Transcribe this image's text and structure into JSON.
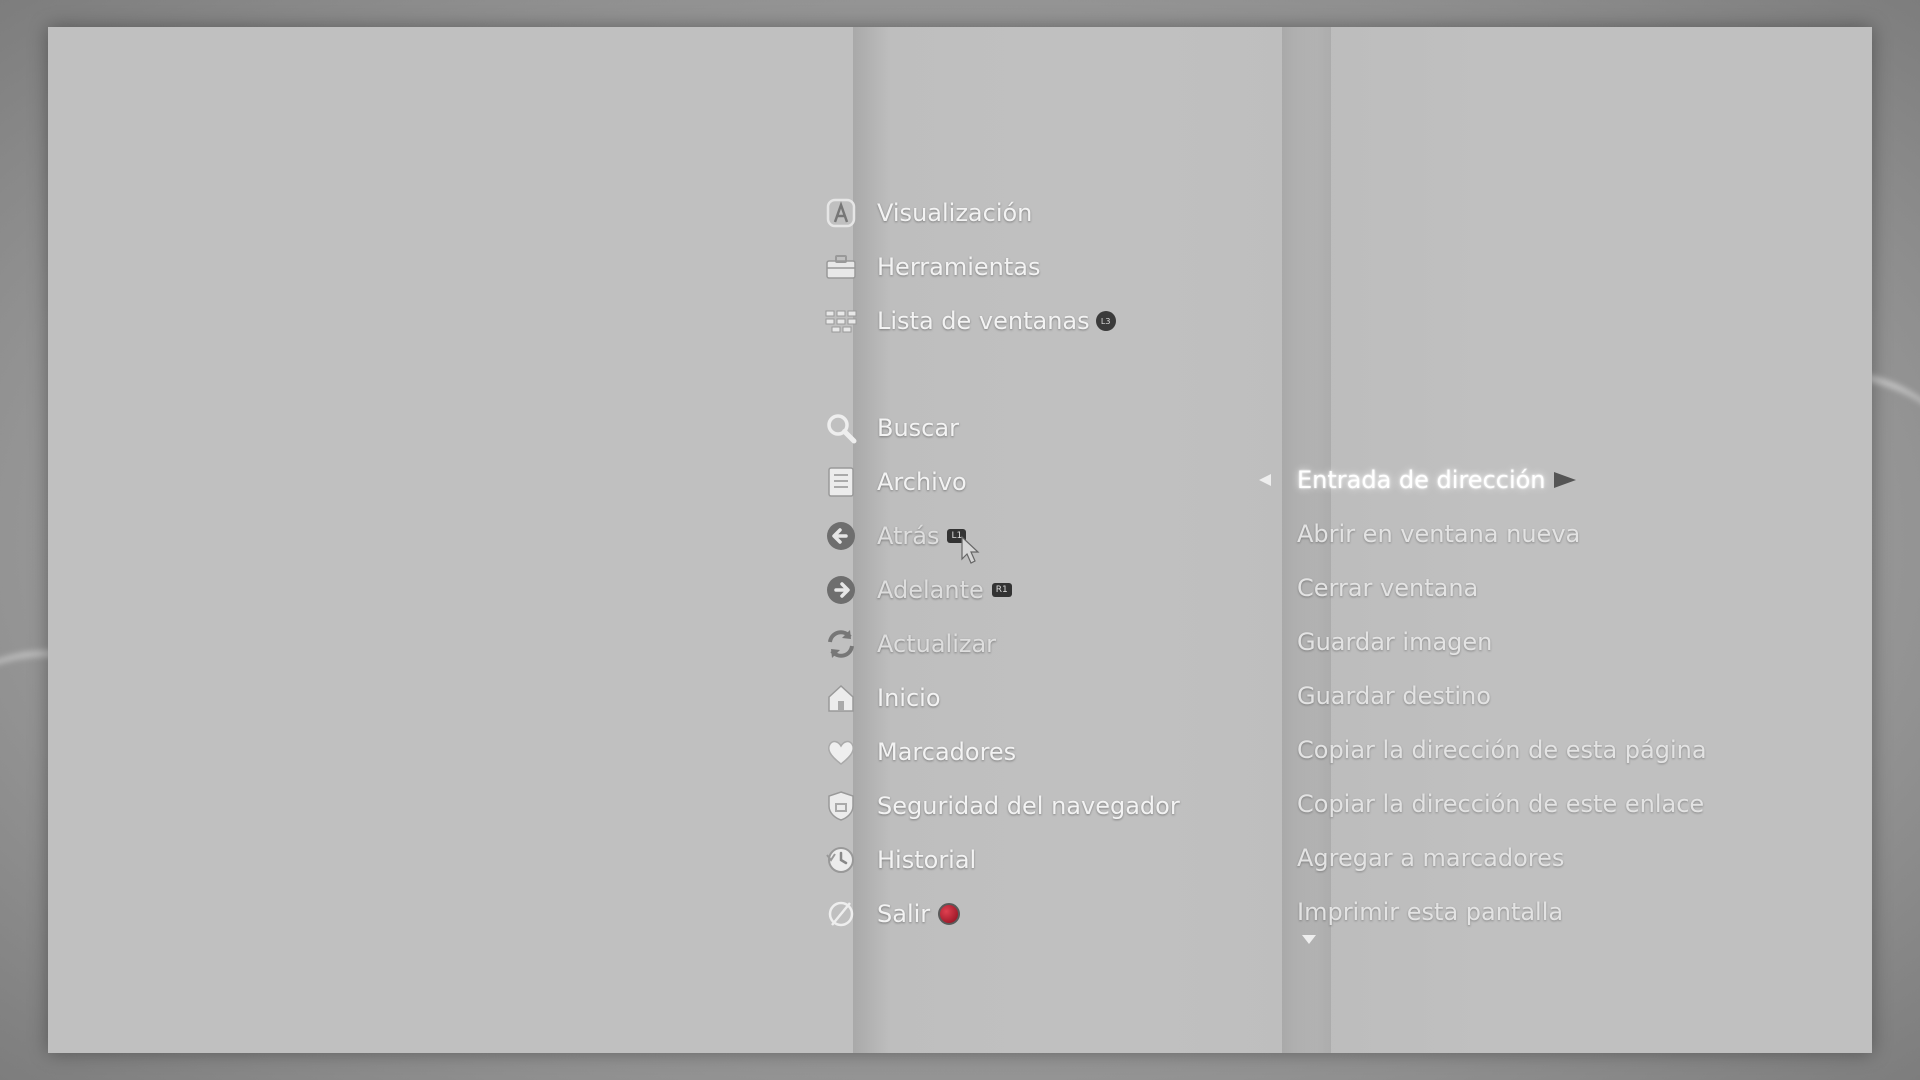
{
  "menu": {
    "items": [
      {
        "label": "Visualización",
        "icon": "letter-a-icon"
      },
      {
        "label": "Herramientas",
        "icon": "toolbox-icon"
      },
      {
        "label": "Lista de ventanas",
        "icon": "window-list-icon",
        "badge": "L3"
      },
      {
        "label": "Buscar",
        "icon": "search-icon"
      },
      {
        "label": "Archivo",
        "icon": "file-icon"
      },
      {
        "label": "Atrás",
        "icon": "back-arrow-icon",
        "badge": "L1"
      },
      {
        "label": "Adelante",
        "icon": "forward-arrow-icon",
        "badge": "R1"
      },
      {
        "label": "Actualizar",
        "icon": "refresh-icon"
      },
      {
        "label": "Inicio",
        "icon": "home-icon"
      },
      {
        "label": "Marcadores",
        "icon": "heart-icon"
      },
      {
        "label": "Seguridad del navegador",
        "icon": "shield-icon"
      },
      {
        "label": "Historial",
        "icon": "history-icon"
      },
      {
        "label": "Salir",
        "icon": "exit-icon",
        "badge": "circle-button"
      }
    ],
    "selected": "Archivo"
  },
  "submenu": {
    "items": [
      {
        "label": "Entrada de dirección",
        "selected": true
      },
      {
        "label": "Abrir en ventana nueva"
      },
      {
        "label": "Cerrar ventana"
      },
      {
        "label": "Guardar imagen"
      },
      {
        "label": "Guardar destino"
      },
      {
        "label": "Copiar la dirección de esta página"
      },
      {
        "label": "Copiar la dirección de este enlace"
      },
      {
        "label": "Agregar a marcadores"
      },
      {
        "label": "Imprimir esta pantalla"
      }
    ]
  },
  "colors": {
    "panel": "#c0c0c0",
    "text": "#f3f3f3",
    "exit_badge": "#b01a2a"
  }
}
